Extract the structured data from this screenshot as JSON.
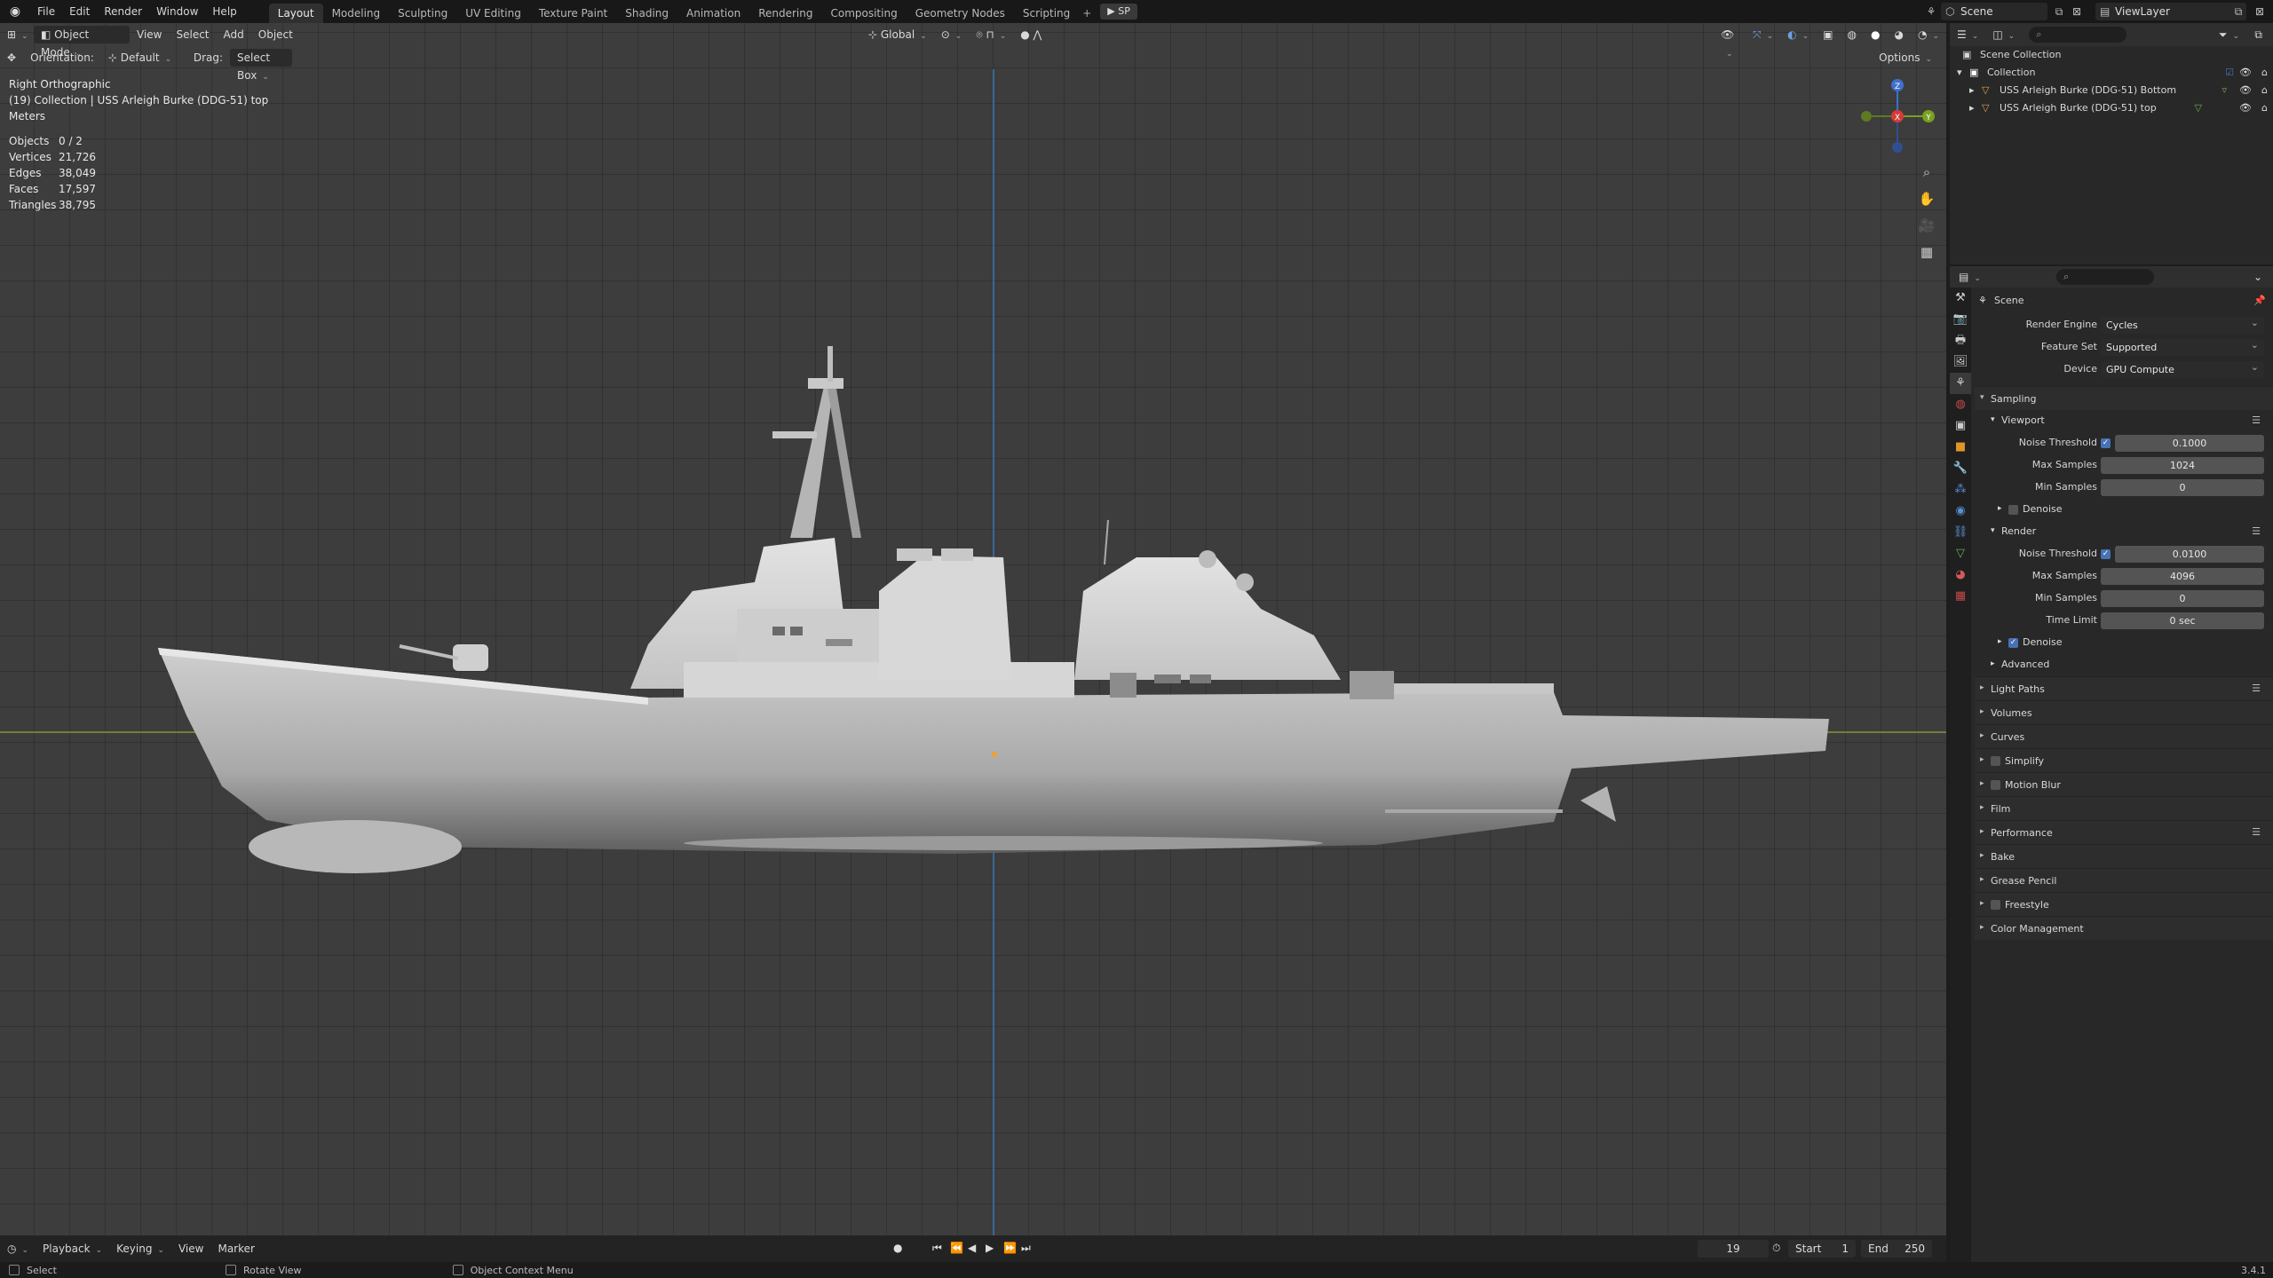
{
  "topbar": {
    "menus": [
      "File",
      "Edit",
      "Render",
      "Window",
      "Help"
    ],
    "workspaces": [
      "Layout",
      "Modeling",
      "Sculpting",
      "UV Editing",
      "Texture Paint",
      "Shading",
      "Animation",
      "Rendering",
      "Compositing",
      "Geometry Nodes",
      "Scripting"
    ],
    "active_workspace": "Layout",
    "sp_button": "SP",
    "scene": "Scene",
    "view_layer": "ViewLayer"
  },
  "viewport": {
    "mode": "Object Mode",
    "menus": [
      "View",
      "Select",
      "Add",
      "Object"
    ],
    "transform": "Global",
    "orientation_label": "Orientation:",
    "orientation_value": "Default",
    "drag_label": "Drag:",
    "drag_value": "Select Box",
    "options": "Options",
    "view_name": "Right Orthographic",
    "collection_info": "(19) Collection | USS Arleigh Burke (DDG-51) top",
    "units": "Meters",
    "stats": [
      {
        "label": "Objects",
        "value": "0 / 2"
      },
      {
        "label": "Vertices",
        "value": "21,726"
      },
      {
        "label": "Edges",
        "value": "38,049"
      },
      {
        "label": "Faces",
        "value": "17,597"
      },
      {
        "label": "Triangles",
        "value": "38,795"
      }
    ],
    "gizmo": {
      "z": "Z",
      "x": "X",
      "y": "Y"
    }
  },
  "outliner": {
    "root": "Scene Collection",
    "collection": "Collection",
    "objects": [
      "USS Arleigh Burke (DDG-51) Bottom",
      "USS Arleigh Burke (DDG-51) top"
    ]
  },
  "properties": {
    "context": "Scene",
    "render_engine_label": "Render Engine",
    "render_engine": "Cycles",
    "feature_set_label": "Feature Set",
    "feature_set": "Supported",
    "device_label": "Device",
    "device": "GPU Compute",
    "sampling": "Sampling",
    "viewport_section": "Viewport",
    "viewport_noise_label": "Noise Threshold",
    "viewport_noise": "0.1000",
    "viewport_max_label": "Max Samples",
    "viewport_max": "1024",
    "viewport_min_label": "Min Samples",
    "viewport_min": "0",
    "denoise": "Denoise",
    "render_section": "Render",
    "render_noise_label": "Noise Threshold",
    "render_noise": "0.0100",
    "render_max_label": "Max Samples",
    "render_max": "4096",
    "render_min_label": "Min Samples",
    "render_min": "0",
    "time_limit_label": "Time Limit",
    "time_limit": "0 sec",
    "render_denoise": "Denoise",
    "advanced": "Advanced",
    "sections": [
      "Light Paths",
      "Volumes",
      "Curves",
      "Simplify",
      "Motion Blur",
      "Film",
      "Performance",
      "Bake",
      "Grease Pencil",
      "Freestyle",
      "Color Management"
    ]
  },
  "timeline": {
    "menus": [
      "Playback",
      "Keying",
      "View",
      "Marker"
    ],
    "current_frame": "19",
    "start_label": "Start",
    "start": "1",
    "end_label": "End",
    "end": "250"
  },
  "statusbar": {
    "select": "Select",
    "rotate": "Rotate View",
    "context_menu": "Object Context Menu",
    "version": "3.4.1"
  },
  "colors": {
    "accent": "#4772b3",
    "axis_y": "#3a6ea5",
    "axis_x": "#7c8a38"
  }
}
